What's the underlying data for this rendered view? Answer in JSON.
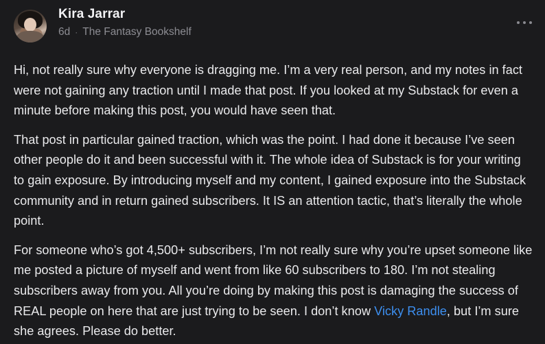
{
  "post": {
    "author": "Kira Jarrar",
    "age": "6d",
    "separator": "·",
    "publication": "The Fantasy Bookshelf",
    "paragraph1": "Hi, not really sure why everyone is dragging me. I’m a very real person, and my notes in fact were not gaining any traction until I made that post. If you looked at my Substack for even a minute before making this post, you would have seen that.",
    "paragraph2": "That post in particular gained traction, which was the point. I had done it because I’ve seen other people do it and been successful with it. The whole idea of Substack is for your writing to gain exposure. By introducing myself and my content, I gained exposure into the Substack community and in return gained subscribers. It IS an attention tactic, that’s literally the whole point.",
    "paragraph3_before": "For someone who’s got 4,500+ subscribers, I’m not really sure why you’re upset someone like me posted a picture of myself and went from like 60 subscribers to 180. I’m not stealing subscribers away from you. All you’re doing by making this post is damaging the success of REAL people on here that are just trying to be seen. I don’t know ",
    "mention": "Vicky Randle",
    "paragraph3_after": ", but I’m sure she agrees. Please do better."
  },
  "icons": {
    "menu": "more-horizontal-icon"
  },
  "colors": {
    "background": "#1b1b1d",
    "text": "#eaeaec",
    "meta": "#8d8d93",
    "mention": "#3d8ff0"
  }
}
